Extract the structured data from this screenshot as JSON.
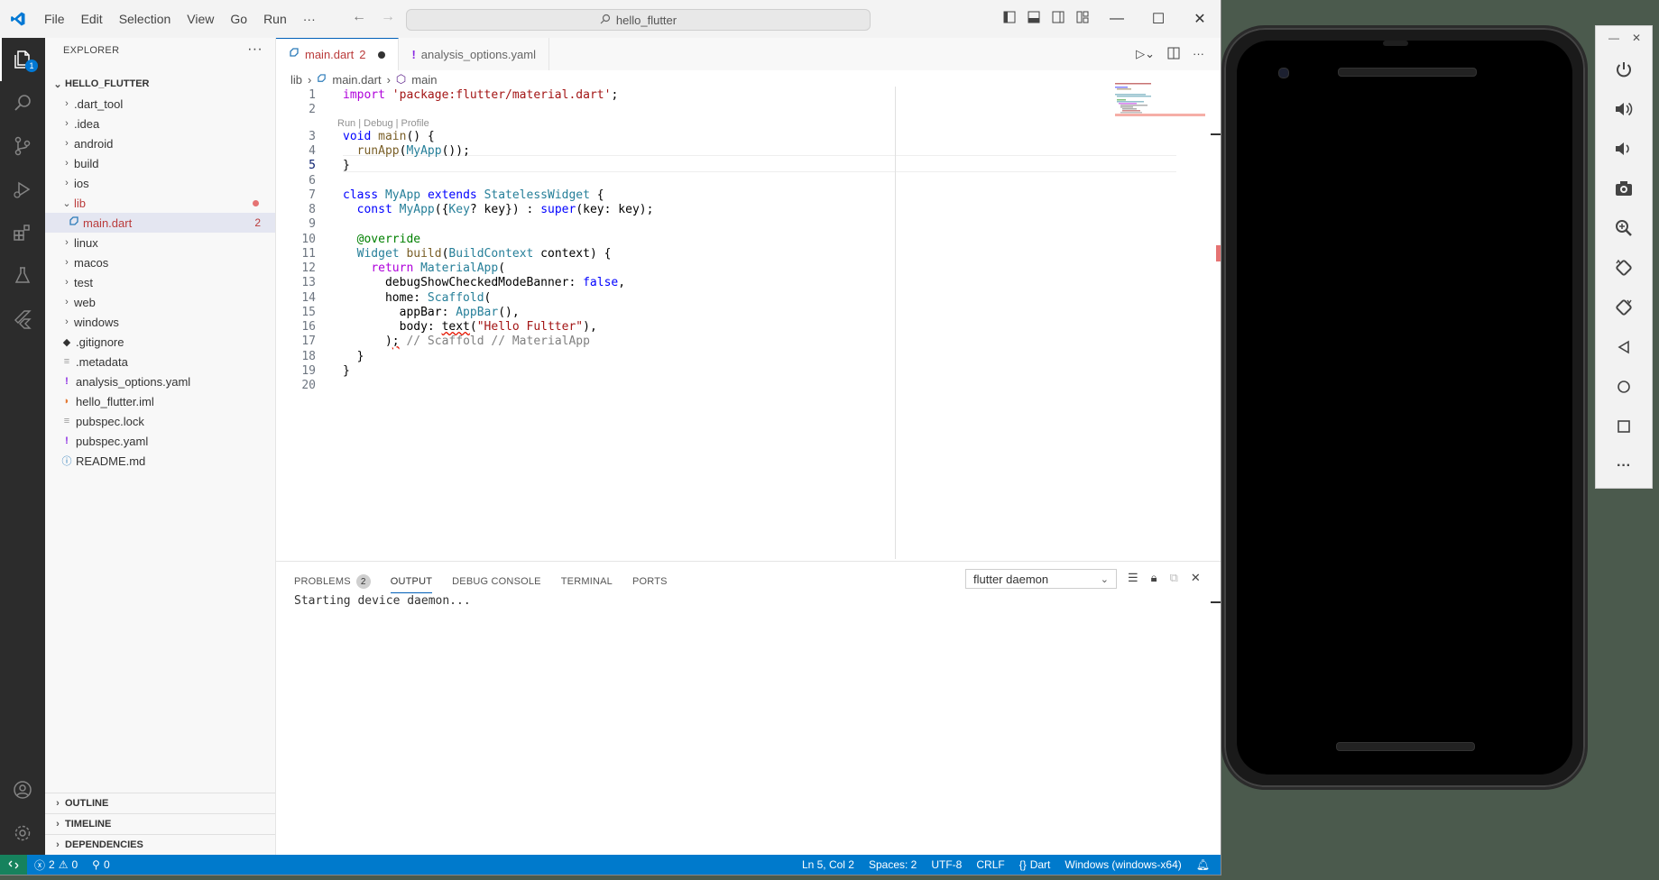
{
  "titlebar": {
    "menu": [
      "File",
      "Edit",
      "Selection",
      "View",
      "Go",
      "Run"
    ],
    "more": "···",
    "search": "hello_flutter"
  },
  "activity": {
    "explorer_badge": "1"
  },
  "sidebar": {
    "header": "EXPLORER",
    "more": "···",
    "folder": "HELLO_FLUTTER",
    "items": [
      {
        "label": ".dart_tool",
        "type": "folder"
      },
      {
        "label": ".idea",
        "type": "folder"
      },
      {
        "label": "android",
        "type": "folder"
      },
      {
        "label": "build",
        "type": "folder"
      },
      {
        "label": "ios",
        "type": "folder"
      },
      {
        "label": "lib",
        "type": "folder-open"
      },
      {
        "label": "main.dart",
        "type": "file",
        "badge": "2"
      },
      {
        "label": "linux",
        "type": "folder"
      },
      {
        "label": "macos",
        "type": "folder"
      },
      {
        "label": "test",
        "type": "folder"
      },
      {
        "label": "web",
        "type": "folder"
      },
      {
        "label": "windows",
        "type": "folder"
      },
      {
        "label": ".gitignore",
        "type": "file"
      },
      {
        "label": ".metadata",
        "type": "file"
      },
      {
        "label": "analysis_options.yaml",
        "type": "file"
      },
      {
        "label": "hello_flutter.iml",
        "type": "file"
      },
      {
        "label": "pubspec.lock",
        "type": "file"
      },
      {
        "label": "pubspec.yaml",
        "type": "file"
      },
      {
        "label": "README.md",
        "type": "file"
      }
    ],
    "sections": [
      "OUTLINE",
      "TIMELINE",
      "DEPENDENCIES"
    ]
  },
  "tabs": [
    {
      "label": "main.dart",
      "badge": "2"
    },
    {
      "label": "analysis_options.yaml"
    }
  ],
  "breadcrumb": [
    "lib",
    "main.dart",
    "main"
  ],
  "editor": {
    "codelens": "Run | Debug | Profile",
    "lines": [
      "1",
      "2",
      "3",
      "4",
      "5",
      "6",
      "7",
      "8",
      "9",
      "10",
      "11",
      "12",
      "13",
      "14",
      "15",
      "16",
      "17",
      "18",
      "19",
      "20"
    ]
  },
  "panel": {
    "tabs": [
      "PROBLEMS",
      "OUTPUT",
      "DEBUG CONSOLE",
      "TERMINAL",
      "PORTS"
    ],
    "problems_count": "2",
    "channel": "flutter daemon",
    "output": "Starting device daemon..."
  },
  "statusbar": {
    "errors": "2",
    "warnings": "0",
    "ports": "0",
    "position": "Ln 5, Col 2",
    "spaces": "Spaces: 2",
    "encoding": "UTF-8",
    "eol": "CRLF",
    "language": "Dart",
    "device": "Windows (windows-x64)"
  },
  "colors": {
    "statusbar": "#007acc",
    "activitybar": "#2c2c2c",
    "accent": "#005fb8"
  }
}
